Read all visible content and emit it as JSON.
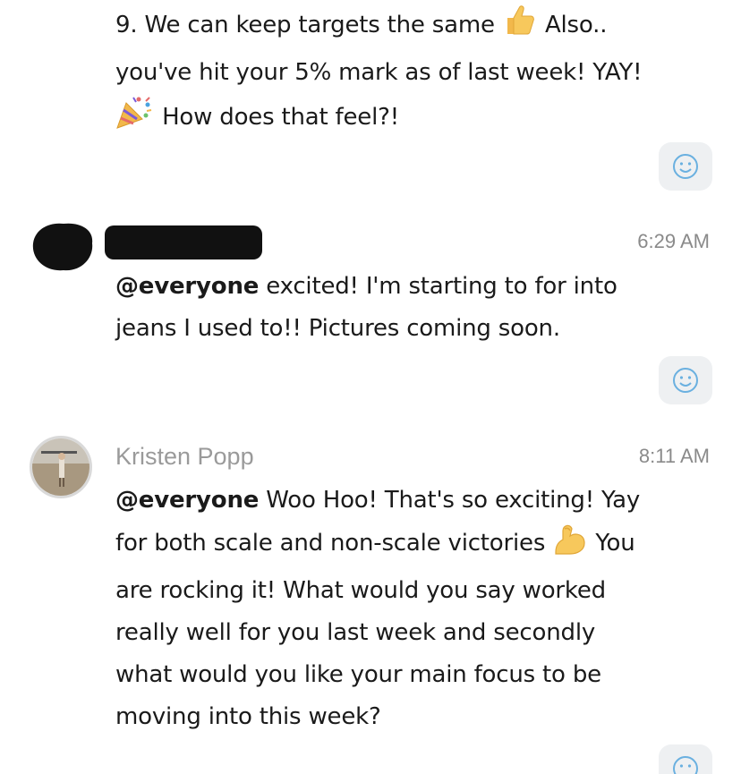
{
  "messages": [
    {
      "lines": [
        "9. We can keep targets the same",
        "Also..",
        "you've hit your 5% mark as of last week! YAY!",
        "How does that feel?!"
      ]
    },
    {
      "time": "6:29 AM",
      "mention": "@everyone",
      "text_line1": " excited! I'm starting to for into",
      "text_line2": "jeans I used to!! Pictures coming soon."
    },
    {
      "sender": "Kristen Popp",
      "time": "8:11 AM",
      "mention": "@everyone",
      "line1": " Woo Hoo! That's so exciting! Yay",
      "line2a": "for both scale and non-scale victories",
      "line2b": " You",
      "line3": "are rocking it! What would you say worked",
      "line4": "really well for you last week and secondly",
      "line5": "what would you like your main focus to be",
      "line6": "moving into this week?"
    }
  ],
  "icons": {
    "reaction": "smiley-icon",
    "thumbs_up": "thumbs-up-icon",
    "party": "party-popper-icon",
    "muscle": "flexed-biceps-icon"
  },
  "colors": {
    "reaction_bg": "#eef0f2",
    "reaction_icon": "#6ab0e0",
    "timestamp": "#8a8a8a"
  }
}
